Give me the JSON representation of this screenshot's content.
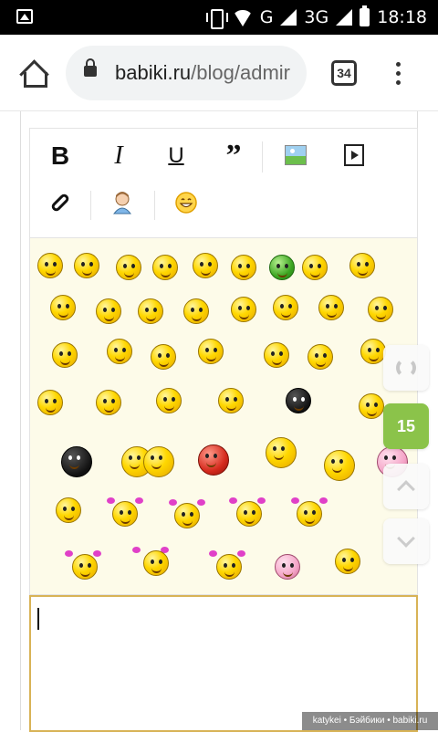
{
  "status_bar": {
    "network": "G",
    "network2": "3G",
    "time": "18:18"
  },
  "browser": {
    "url_host": "babiki.ru",
    "url_path": "/blog/admir",
    "tab_count": "34"
  },
  "editor": {
    "toolbar": {
      "bold": "B",
      "italic": "I",
      "underline": "U",
      "quote": "”"
    },
    "text_value": ""
  },
  "floating": {
    "comment_count": "15"
  },
  "watermark": "katykei • Бэйбики • babiki.ru"
}
